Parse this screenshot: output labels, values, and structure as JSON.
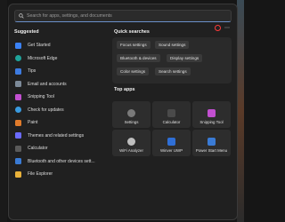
{
  "search": {
    "placeholder": "Search for apps, settings, and documents"
  },
  "suggested": {
    "title": "Suggested",
    "items": [
      {
        "label": "Get Started",
        "color": "#3b82f6"
      },
      {
        "label": "Microsoft Edge",
        "color": "#1fa39a"
      },
      {
        "label": "Tips",
        "color": "#3d7be0"
      },
      {
        "label": "Email and accounts",
        "color": "#7d8a99"
      },
      {
        "label": "Snipping Tool",
        "color": "#c24fd0"
      },
      {
        "label": "Check for updates",
        "color": "#3a9be0"
      },
      {
        "label": "Paint",
        "color": "#e07b2b"
      },
      {
        "label": "Themes and related settings",
        "color": "#6b6bff"
      },
      {
        "label": "Calculator",
        "color": "#5a5a5a"
      },
      {
        "label": "Bluetooth and other devices sett...",
        "color": "#3a7bd5"
      },
      {
        "label": "File Explorer",
        "color": "#e8b13a"
      }
    ]
  },
  "quick_searches": {
    "title": "Quick searches",
    "items": [
      "Focus settings",
      "Sound settings",
      "Bluetooth & devices",
      "Display settings",
      "Color settings",
      "Search settings"
    ]
  },
  "top_apps": {
    "title": "Top apps",
    "items": [
      {
        "label": "Settings",
        "color": "#7a7a7a"
      },
      {
        "label": "Calculator",
        "color": "#4a4a4a"
      },
      {
        "label": "Snipping Tool",
        "color": "#c24fd0"
      },
      {
        "label": "WiFi Analyzer",
        "color": "#bfbfbf"
      },
      {
        "label": "Winver UWP",
        "color": "#2f6fd6"
      },
      {
        "label": "Power Start Menu",
        "color": "#3a7bd5"
      }
    ]
  },
  "accent": "#6a8fc9"
}
